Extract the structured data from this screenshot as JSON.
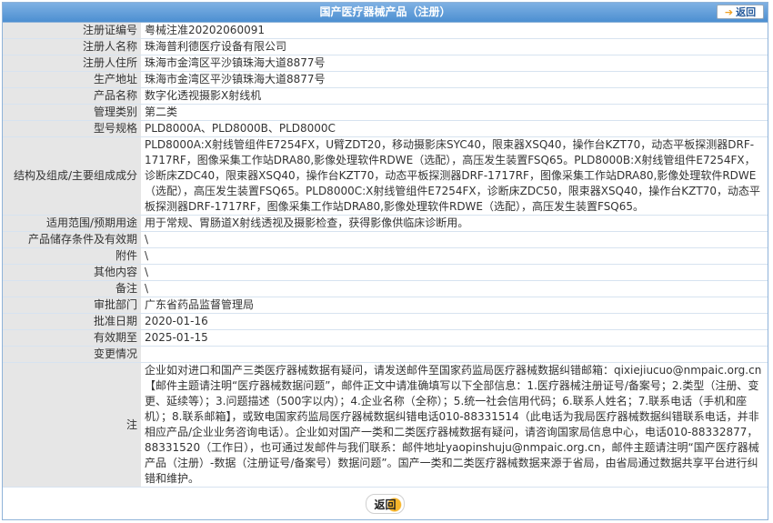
{
  "header": {
    "title": "国产医疗器械产品（注册）",
    "back_label": "返回"
  },
  "rows": [
    {
      "label": "注册证编号",
      "value": "粤械注准20202060091"
    },
    {
      "label": "注册人名称",
      "value": "珠海普利德医疗设备有限公司"
    },
    {
      "label": "注册人住所",
      "value": "珠海市金湾区平沙镇珠海大道8877号"
    },
    {
      "label": "生产地址",
      "value": "珠海市金湾区平沙镇珠海大道8877号"
    },
    {
      "label": "产品名称",
      "value": "数字化透视摄影X射线机"
    },
    {
      "label": "管理类别",
      "value": "第二类"
    },
    {
      "label": "型号规格",
      "value": "PLD8000A、PLD8000B、PLD8000C"
    },
    {
      "label": "结构及组成/主要组成成分",
      "value": "PLD8000A:X射线管组件E7254FX，U臂ZDT20，移动摄影床SYC40，限束器XSQ40，操作台KZT70，动态平板探测器DRF-1717RF，图像采集工作站DRA80,影像处理软件RDWE（选配），高压发生装置FSQ65。PLD8000B:X射线管组件E7254FX，诊断床ZDC40，限束器XSQ40，操作台KZT70，动态平板探测器DRF-1717RF，图像采集工作站DRA80,影像处理软件RDWE（选配），高压发生装置FSQ65。PLD8000C:X射线管组件E7254FX，诊断床ZDC50，限束器XSQ40，操作台KZT70，动态平板探测器DRF-1717RF，图像采集工作站DRA80,影像处理软件RDWE（选配），高压发生装置FSQ65。"
    },
    {
      "label": "适用范围/预期用途",
      "value": "用于常规、胃肠道X射线透视及摄影检查，获得影像供临床诊断用。"
    },
    {
      "label": "产品储存条件及有效期",
      "value": "\\"
    },
    {
      "label": "附件",
      "value": "\\"
    },
    {
      "label": "其他内容",
      "value": "\\"
    },
    {
      "label": "备注",
      "value": "\\"
    },
    {
      "label": "审批部门",
      "value": "广东省药品监督管理局"
    },
    {
      "label": "批准日期",
      "value": "2020-01-16"
    },
    {
      "label": "有效期至",
      "value": "2025-01-15"
    },
    {
      "label": "变更情况",
      "value": ""
    },
    {
      "label": "注",
      "value": "企业如对进口和国产三类医疗器械数据有疑问，请发送邮件至国家药监局医疗器械数据纠错邮箱：qixiejiucuo@nmpaic.org.cn【邮件主题请注明“医疗器械数据问题”，邮件正文中请准确填写以下全部信息：1.医疗器械注册证号/备案号；2.类型（注册、变更、延续等）；3.问题描述（500字以内）；4.企业名称（全称）；5.统一社会信用代码；6.联系人姓名；7.联系电话（手机和座机）；8.联系邮箱】，或致电国家药监局医疗器械数据纠错电话010-88331514（此电话为我局医疗器械数据纠错联系电话，并非相应产品/企业业务咨询电话）。企业如对国产一类和二类医疗器械数据有疑问，请咨询国家局信息中心，电话010-88332877，88331520（工作日），也可通过发邮件与我们联系：邮件地址yaopinshuju@nmpaic.org.cn，邮件主题请注明“国产医疗器械产品（注册）-数据（注册证号/备案号）数据问题”。国产一类和二类医疗器械数据来源于省局，由省局通过数据共享平台进行纠错和维护。"
    }
  ],
  "footer": {
    "back_label": "返回"
  }
}
